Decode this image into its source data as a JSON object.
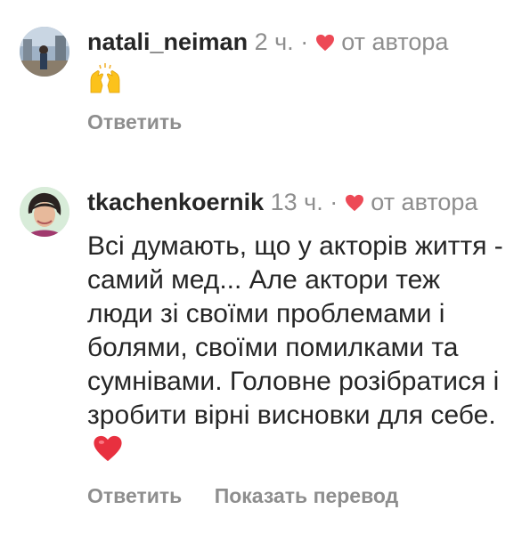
{
  "comments": [
    {
      "username": "natali_neiman",
      "time": "2 ч.",
      "separator": "·",
      "author_label": "от автора",
      "emoji": "raising-hands",
      "reply_label": "Ответить"
    },
    {
      "username": "tkachenkoernik",
      "time": "13 ч.",
      "separator": "·",
      "author_label": "от автора",
      "text": "Всі думають, що у акторів життя - самий мед... Але актори теж люди зі своїми проблемами і болями, своїми помилками та сумнівами. Головне розібратися і зробити вірні висновки для себе.",
      "text_emoji": "red-heart",
      "reply_label": "Ответить",
      "translate_label": "Показать перевод"
    }
  ],
  "colors": {
    "text": "#262626",
    "secondary": "#8e8e8e",
    "heart": "#ed4956"
  }
}
